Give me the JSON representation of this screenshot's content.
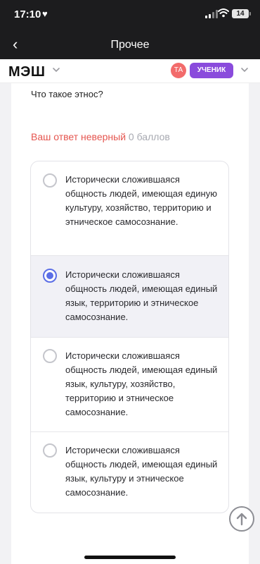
{
  "status_bar": {
    "time": "17:10",
    "battery": "14",
    "icons": [
      "heart-icon",
      "signal-icon",
      "wifi-icon",
      "battery-icon"
    ]
  },
  "nav": {
    "title": "Прочее",
    "back_icon": "chevron-left-icon"
  },
  "header": {
    "logo": "МЭШ",
    "avatar_initials": "ТА",
    "role": "УЧЕНИК"
  },
  "question": {
    "text": "Что такое этнос?"
  },
  "result": {
    "status": "Ваш ответ неверный",
    "score": "0 баллов"
  },
  "options": [
    {
      "text": "Исторически сложившаяся общность людей, имеющая единую культуру, хозяйство, территорию и этническое самосознание.",
      "selected": false
    },
    {
      "text": "Исторически сложившаяся общность людей, имеющая единый язык, территорию и этническое самосознание.",
      "selected": true
    },
    {
      "text": "Исторически сложившаяся общность людей, имеющая единый язык, культуру, хозяйство, территорию и этническое самосознание.",
      "selected": false
    },
    {
      "text": "Исторически сложившаяся общность людей, имеющая единый язык, культуру и этническое самосознание.",
      "selected": false
    }
  ],
  "colors": {
    "error": "#e5554f",
    "accent": "#5b6ee6",
    "role_badge": "#8a4bdc",
    "avatar": "#f26b6b"
  }
}
